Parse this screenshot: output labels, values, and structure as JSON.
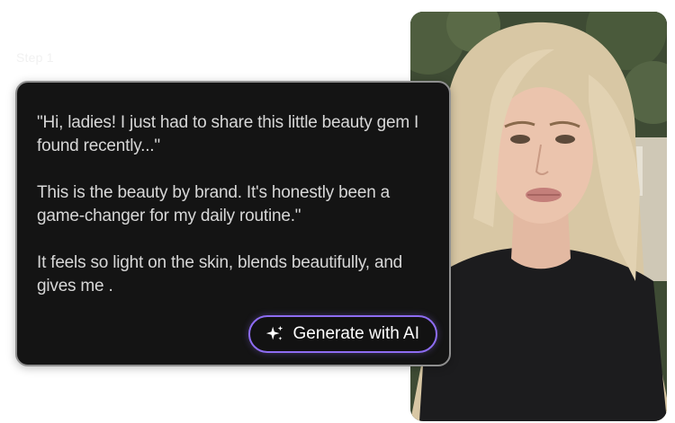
{
  "step_label": "Step 1",
  "script": {
    "paragraphs": [
      "\"Hi, ladies! I just had to share this little beauty gem I found recently...\"",
      "This is the beauty by brand. It's honestly been a game-changer for my daily routine.\"",
      "It feels so light on the skin, blends beautifully, and gives me ."
    ]
  },
  "generate_button": {
    "label": "Generate with AI",
    "icon": "sparkle-icon",
    "border_color": "#8d6cf2"
  },
  "colors": {
    "card_background": "#141414",
    "card_border": "#8f8f8f",
    "text": "#d7d7d7"
  }
}
